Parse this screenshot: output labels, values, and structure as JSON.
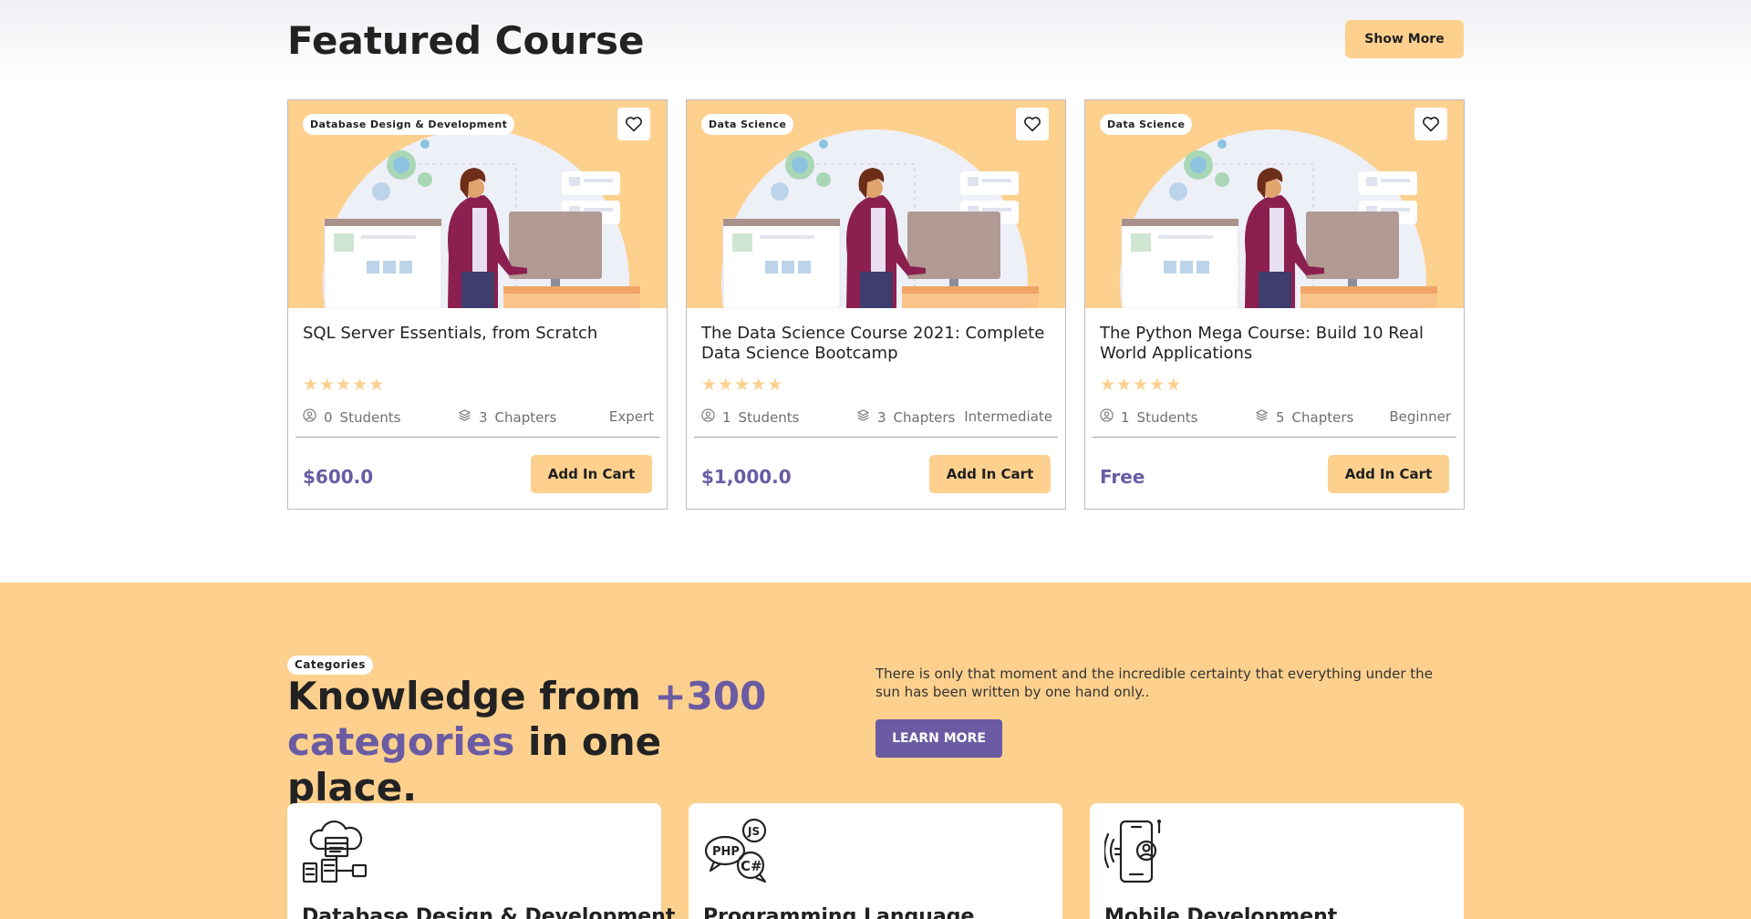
{
  "featured": {
    "title": "Featured Course",
    "show_more_label": "Show More",
    "cards": [
      {
        "tag": "Database Design & Development",
        "title": "SQL Server Essentials, from Scratch",
        "rating": 5,
        "students": "0",
        "students_label": "Students",
        "chapters": "3",
        "chapters_label": "Chapters",
        "level": "Expert",
        "price": "$600.0",
        "cart_label": "Add In Cart"
      },
      {
        "tag": "Data Science",
        "title": "The Data Science Course 2021: Complete Data Science Bootcamp",
        "rating": 5,
        "students": "1",
        "students_label": "Students",
        "chapters": "3",
        "chapters_label": "Chapters",
        "level": "Intermediate",
        "price": "$1,000.0",
        "cart_label": "Add In Cart"
      },
      {
        "tag": "Data Science",
        "title": "The Python Mega Course: Build 10 Real World Applications",
        "rating": 5,
        "students": "1",
        "students_label": "Students",
        "chapters": "5",
        "chapters_label": "Chapters",
        "level": "Beginner",
        "price": "Free",
        "cart_label": "Add In Cart"
      }
    ]
  },
  "categories": {
    "pill": "Categories",
    "title_part1": "Knowledge from ",
    "title_accent1": "+300",
    "title_accent2": "categories",
    "title_part2": " in one place.",
    "description": "There is only that moment and the incredible certainty that everything under the sun has been written by one hand only..",
    "learn_more_label": "LEARN MORE",
    "items": [
      {
        "label": "Database Design & Development",
        "icon": "database-cloud-icon"
      },
      {
        "label": "Programming Language",
        "icon": "code-languages-icon"
      },
      {
        "label": "Mobile Development",
        "icon": "mobile-user-icon"
      }
    ]
  },
  "colors": {
    "accent": "#fdd08e",
    "brand": "#6a5ba3"
  }
}
